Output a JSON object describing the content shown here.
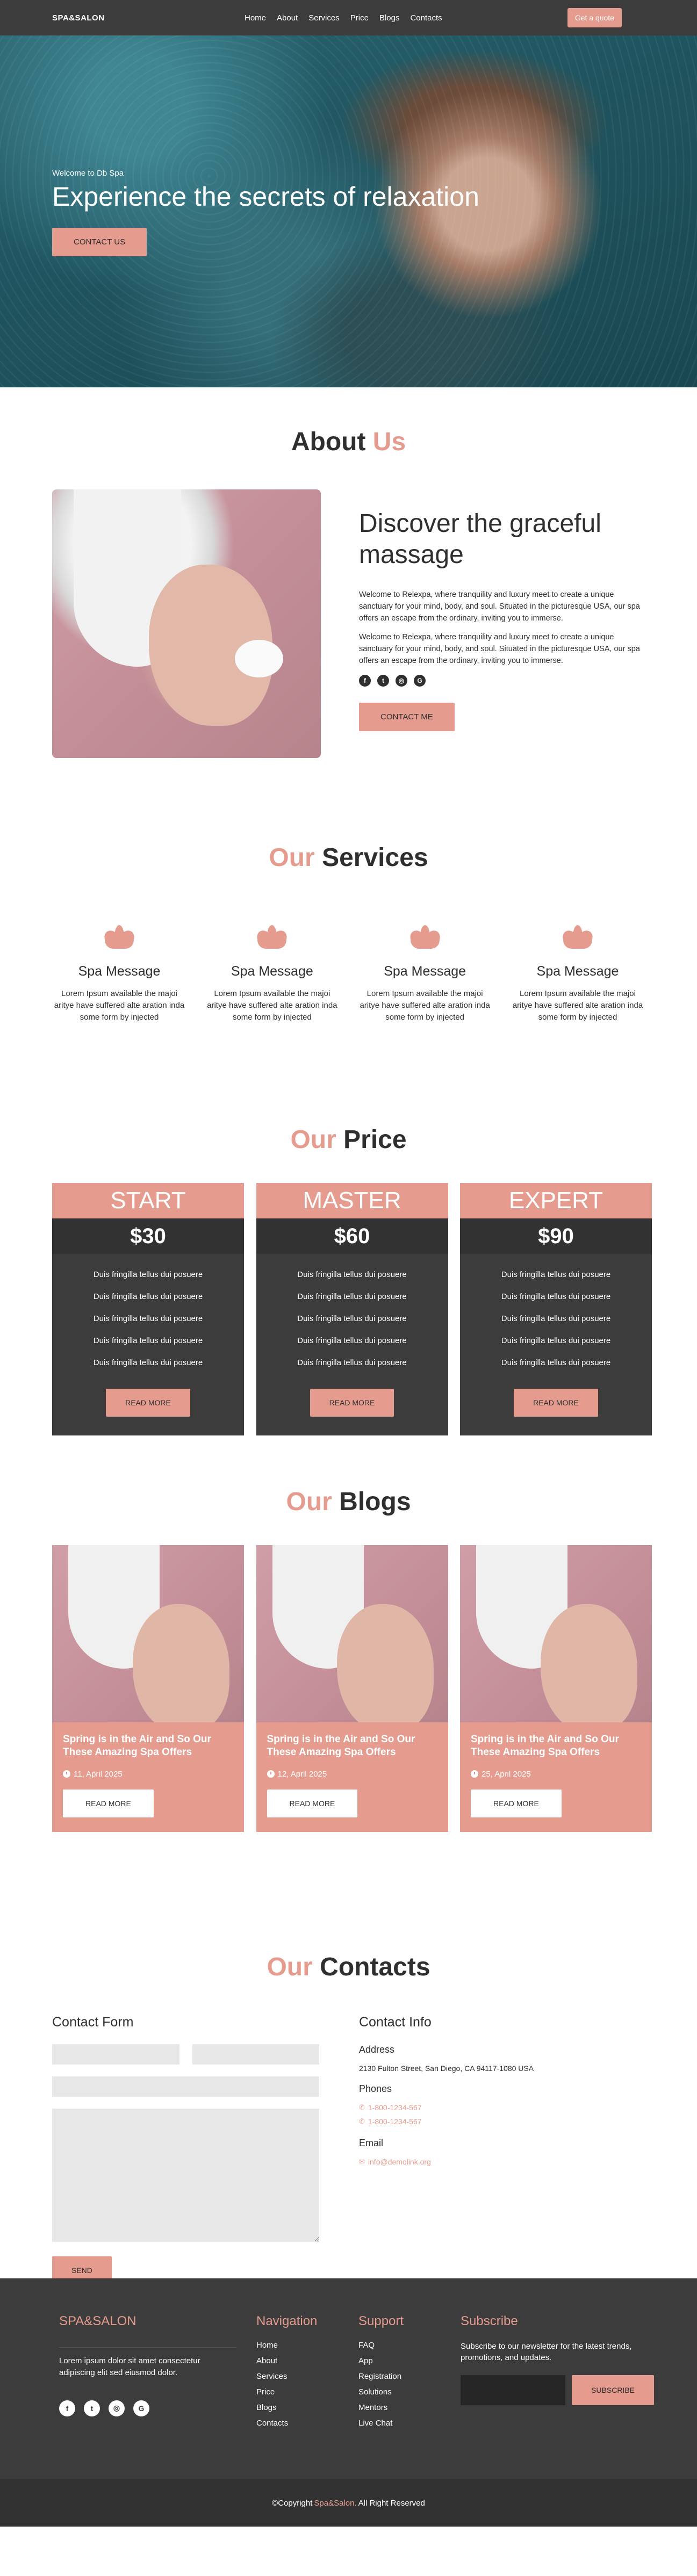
{
  "nav": {
    "brand": "SPA&SALON",
    "links": [
      "Home",
      "About",
      "Services",
      "Price",
      "Blogs",
      "Contacts"
    ],
    "cta": "Get a quote"
  },
  "hero": {
    "welcome": "Welcome to Db Spa",
    "title": "Experience the secrets of relaxation",
    "button": "CONTACT US"
  },
  "about": {
    "title_dark": "About",
    "title_accent": "Us",
    "heading": "Discover the graceful massage",
    "paragraphs": [
      "Welcome to Relexpa, where tranquility and luxury meet to create a unique sanctuary for your mind, body, and soul. Situated in the picturesque USA, our spa offers an escape from the ordinary, inviting you to immerse.",
      "Welcome to Relexpa, where tranquility and luxury meet to create a unique sanctuary for your mind, body, and soul. Situated in the picturesque USA, our spa offers an escape from the ordinary, inviting you to immerse."
    ],
    "button": "CONTACT ME"
  },
  "services": {
    "title_accent": "Our",
    "title_dark": "Services",
    "items": [
      {
        "title": "Spa Message",
        "desc": "Lorem Ipsum available the majoi aritye have suffered alte aration inda some form by injected"
      },
      {
        "title": "Spa Message",
        "desc": "Lorem Ipsum available the majoi aritye have suffered alte aration inda some form by injected"
      },
      {
        "title": "Spa Message",
        "desc": "Lorem Ipsum available the majoi aritye have suffered alte aration inda some form by injected"
      },
      {
        "title": "Spa Message",
        "desc": "Lorem Ipsum available the majoi aritye have suffered alte aration inda some form by injected"
      }
    ]
  },
  "price": {
    "title_accent": "Our",
    "title_dark": "Price",
    "plans": [
      {
        "name": "START",
        "amount": "$30",
        "features": [
          "Duis fringilla tellus dui posuere",
          "Duis fringilla tellus dui posuere",
          "Duis fringilla tellus dui posuere",
          "Duis fringilla tellus dui posuere",
          "Duis fringilla tellus dui posuere"
        ],
        "button": "READ MORE"
      },
      {
        "name": "MASTER",
        "amount": "$60",
        "features": [
          "Duis fringilla tellus dui posuere",
          "Duis fringilla tellus dui posuere",
          "Duis fringilla tellus dui posuere",
          "Duis fringilla tellus dui posuere",
          "Duis fringilla tellus dui posuere"
        ],
        "button": "READ MORE"
      },
      {
        "name": "EXPERT",
        "amount": "$90",
        "features": [
          "Duis fringilla tellus dui posuere",
          "Duis fringilla tellus dui posuere",
          "Duis fringilla tellus dui posuere",
          "Duis fringilla tellus dui posuere",
          "Duis fringilla tellus dui posuere"
        ],
        "button": "READ MORE"
      }
    ]
  },
  "blogs": {
    "title_accent": "Our",
    "title_dark": "Blogs",
    "posts": [
      {
        "title": "Spring is in the Air and So Our These Amazing Spa Offers",
        "date": "11, April 2025",
        "button": "READ MORE"
      },
      {
        "title": "Spring is in the Air and So Our These Amazing Spa Offers",
        "date": "12, April 2025",
        "button": "READ MORE"
      },
      {
        "title": "Spring is in the Air and So Our These Amazing Spa Offers",
        "date": "25, April 2025",
        "button": "READ MORE"
      }
    ]
  },
  "contacts": {
    "title_accent": "Our",
    "title_dark": "Contacts",
    "form_heading": "Contact Form",
    "send_button": "SEND",
    "info_heading": "Contact Info",
    "address_label": "Address",
    "address": "2130 Fulton Street, San Diego, CA 94117-1080 USA",
    "phones_label": "Phones",
    "phones": [
      "1-800-1234-567",
      "1-800-1234-567"
    ],
    "email_label": "Email",
    "email": "info@demolink.org"
  },
  "footer": {
    "brand": "SPA&SALON",
    "description": "Lorem ipsum dolor sit amet consectetur adipiscing elit sed eiusmod dolor.",
    "nav_title": "Navigation",
    "nav_items": [
      "Home",
      "About",
      "Services",
      "Price",
      "Blogs",
      "Contacts"
    ],
    "support_title": "Support",
    "support_items": [
      "FAQ",
      "App",
      "Registration",
      "Solutions",
      "Mentors",
      "Live Chat"
    ],
    "subscribe_title": "Subscribe",
    "subscribe_text": "Subscribe to our newsletter for the latest trends, promotions, and updates.",
    "subscribe_button": "SUBSCRIBE",
    "copyright_prefix": "©Copyright",
    "copyright_brand": "Spa&Salon.",
    "copyright_suffix": "All Right Reserved"
  },
  "colors": {
    "accent": "#e59c8f",
    "dark": "#3c3c3c"
  }
}
